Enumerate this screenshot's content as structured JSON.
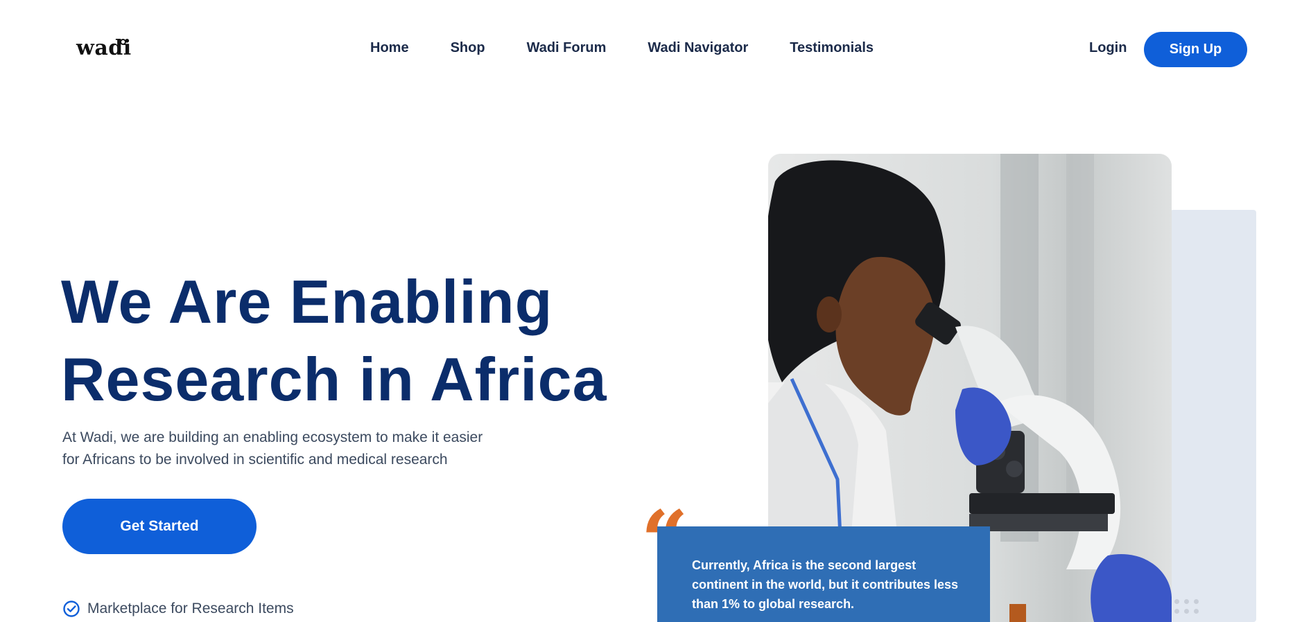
{
  "header": {
    "logo_text": "wadi",
    "nav": [
      {
        "label": "Home"
      },
      {
        "label": "Shop"
      },
      {
        "label": "Wadi Forum"
      },
      {
        "label": "Wadi Navigator"
      },
      {
        "label": "Testimonials"
      }
    ],
    "login_label": "Login",
    "signup_label": "Sign Up"
  },
  "hero": {
    "title_line1": "We Are Enabling",
    "title_line2": "Research in Africa",
    "subtitle_line1": "At Wadi, we are building an enabling ecosystem to make it easier",
    "subtitle_line2": "for Africans to be involved in scientific and medical research",
    "cta_label": "Get Started",
    "features": [
      {
        "label": "Marketplace for Research Items",
        "icon": "check-circle-icon"
      }
    ]
  },
  "quote": {
    "mark": "“",
    "line1": "Currently, Africa is the second largest",
    "line2": "continent in the world, but it contributes less",
    "line3": "than 1% to global research."
  },
  "colors": {
    "primary": "#0f5fd9",
    "heading": "#0b2d6b",
    "quote_box": "#2f6eb5",
    "quote_mark": "#e0702a",
    "accent_panel": "#e2e8f1"
  }
}
